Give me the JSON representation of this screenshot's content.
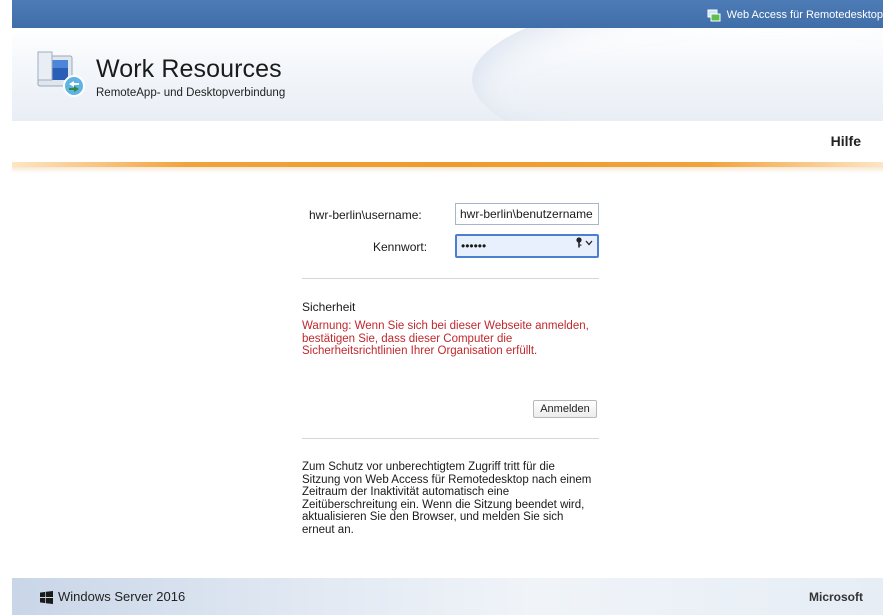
{
  "topbar": {
    "app_name": "Web Access für Remotedesktop",
    "icon": "remote-desktop-icon"
  },
  "header": {
    "title": "Work Resources",
    "subtitle": "RemoteApp- und Desktopverbindung",
    "logo_icon": "remote-connection-logo-icon"
  },
  "nav": {
    "help": "Hilfe"
  },
  "colors": {
    "accent_orange": "#ef9a2b",
    "topbar_blue": "#4372ad",
    "warning_red": "#c0282d"
  },
  "login": {
    "username_label": "hwr-berlin\\username:",
    "username_value": "hwr-berlin\\benutzername",
    "password_label": "Kennwort:",
    "password_value": "••••••",
    "password_icon": "key-icon"
  },
  "security": {
    "title": "Sicherheit",
    "warning": "Warnung: Wenn Sie sich bei dieser Webseite anmelden, bestätigen Sie, dass dieser Computer die Sicherheitsrichtlinien Ihrer Organisation erfüllt."
  },
  "actions": {
    "sign_in": "Anmelden"
  },
  "info": {
    "timeout_notice": "Zum Schutz vor unberechtigtem Zugriff tritt für die Sitzung von Web Access für Remotedesktop nach einem Zeitraum der Inaktivität automatisch eine Zeitüberschreitung ein. Wenn die Sitzung beendet wird, aktualisieren Sie den Browser, und melden Sie sich erneut an."
  },
  "footer": {
    "product": "Windows Server 2016",
    "vendor": "Microsoft"
  }
}
